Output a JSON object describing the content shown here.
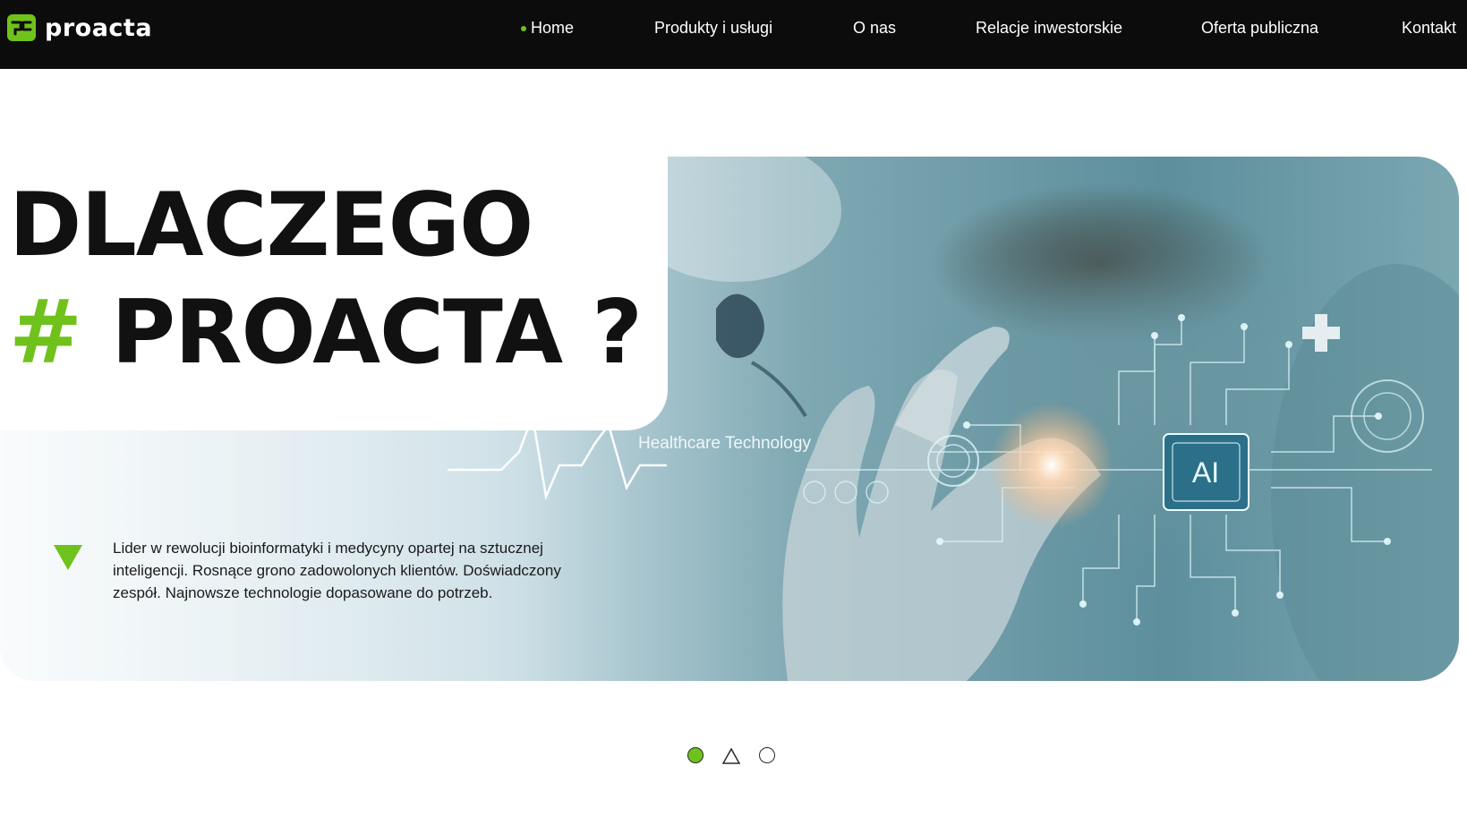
{
  "header": {
    "logo_text": "proacta",
    "brand_color": "#6fc21b",
    "nav": [
      {
        "label": "Home",
        "active": true
      },
      {
        "label": "Produkty i usługi"
      },
      {
        "label": "O nas"
      },
      {
        "label": "Relacje inwestorskie"
      },
      {
        "label": "Oferta publiczna"
      },
      {
        "label": "Kontakt"
      }
    ]
  },
  "hero": {
    "title_line1": "DLACZEGO",
    "title_hash": "#",
    "title_line2": "PROACTA ?",
    "description": "Lider w rewolucji bioinformatyki i medycyny opartej na sztucznej inteligencji. Rosnące grono zadowolonych klientów. Doświadczony zespół. Najnowsze technologie dopasowane do potrzeb.",
    "image_caption": "Healthcare Technology",
    "chip_label": "AI"
  },
  "slider": {
    "slides": 3,
    "active": 1
  }
}
